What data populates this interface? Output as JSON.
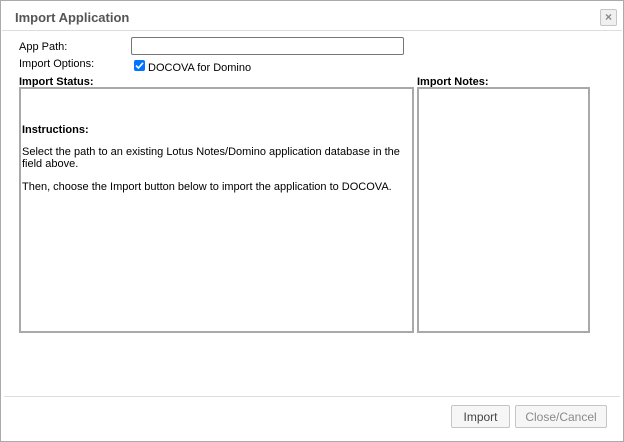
{
  "dialog": {
    "title": "Import Application",
    "close_icon": "×"
  },
  "form": {
    "app_path_label": "App Path:",
    "app_path_value": "",
    "import_options_label": "Import Options:",
    "option_label": "DOCOVA for Domino",
    "option_checked": true
  },
  "status": {
    "header": "Import Status:",
    "instructions_title": "Instructions:",
    "paragraph1": "Select the path to an existing Lotus Notes/Domino application database in the field above.",
    "paragraph2": "Then, choose the Import button below to import the application to DOCOVA."
  },
  "notes": {
    "header": "Import Notes:"
  },
  "buttons": {
    "import_label": "Import",
    "close_cancel_label": "Close/Cancel"
  },
  "colors": {
    "checkbox_accent": "#0075ff",
    "title_text": "#555555"
  }
}
